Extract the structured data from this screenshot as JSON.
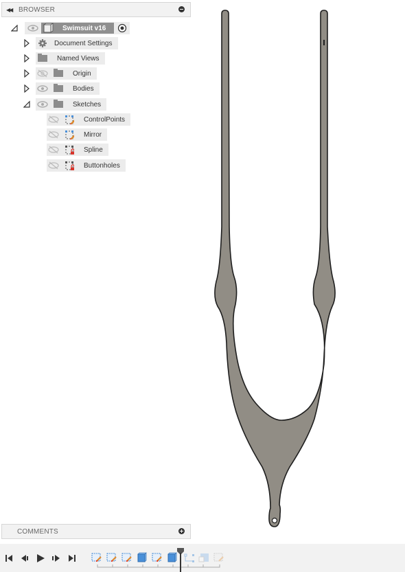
{
  "browser": {
    "title": "BROWSER",
    "collapse_icon": "double-chevron-left-icon",
    "toggle_icon": "minus-circle-icon",
    "root": {
      "label": "Swimsuit v16",
      "expander": "expanded",
      "visible": true,
      "active_icon": "radio-active-icon"
    },
    "items": [
      {
        "label": "Document Settings",
        "icon": "gear-icon",
        "expander": "collapsed",
        "eye": "none"
      },
      {
        "label": "Named Views",
        "icon": "folder-icon",
        "expander": "collapsed",
        "eye": "none"
      },
      {
        "label": "Origin",
        "icon": "folder-icon",
        "expander": "collapsed",
        "eye": "hidden"
      },
      {
        "label": "Bodies",
        "icon": "folder-icon",
        "expander": "collapsed",
        "eye": "visible"
      },
      {
        "label": "Sketches",
        "icon": "folder-icon",
        "expander": "expanded",
        "eye": "visible"
      }
    ],
    "sketches": [
      {
        "label": "ControlPoints",
        "icon": "sketch-edit-icon",
        "eye": "hidden"
      },
      {
        "label": "Mirror",
        "icon": "sketch-edit-icon",
        "eye": "hidden"
      },
      {
        "label": "Spline",
        "icon": "sketch-locked-icon",
        "eye": "hidden"
      },
      {
        "label": "Buttonholes",
        "icon": "sketch-locked-icon",
        "eye": "hidden"
      }
    ]
  },
  "comments": {
    "title": "COMMENTS",
    "toggle_icon": "plus-circle-icon"
  },
  "timeline": {
    "controls": [
      "skip-to-start-icon",
      "step-back-icon",
      "play-icon",
      "step-forward-icon",
      "skip-to-end-icon"
    ],
    "features": [
      {
        "type": "sketch",
        "state": "active"
      },
      {
        "type": "sketch",
        "state": "active"
      },
      {
        "type": "sketch",
        "state": "active"
      },
      {
        "type": "extrude",
        "state": "active"
      },
      {
        "type": "sketch",
        "state": "active"
      },
      {
        "type": "extrude",
        "state": "active"
      },
      {
        "type": "mirror",
        "state": "suppressed"
      },
      {
        "type": "body",
        "state": "suppressed"
      },
      {
        "type": "sketch",
        "state": "suppressed"
      }
    ],
    "marker_after_feature": 6
  },
  "colors": {
    "body_fill": "#918d85",
    "body_outline": "#1e1e1e",
    "active_root": "#8f8f8f",
    "sketch_blue": "#4a90d9",
    "lock_red": "#d9342b"
  }
}
